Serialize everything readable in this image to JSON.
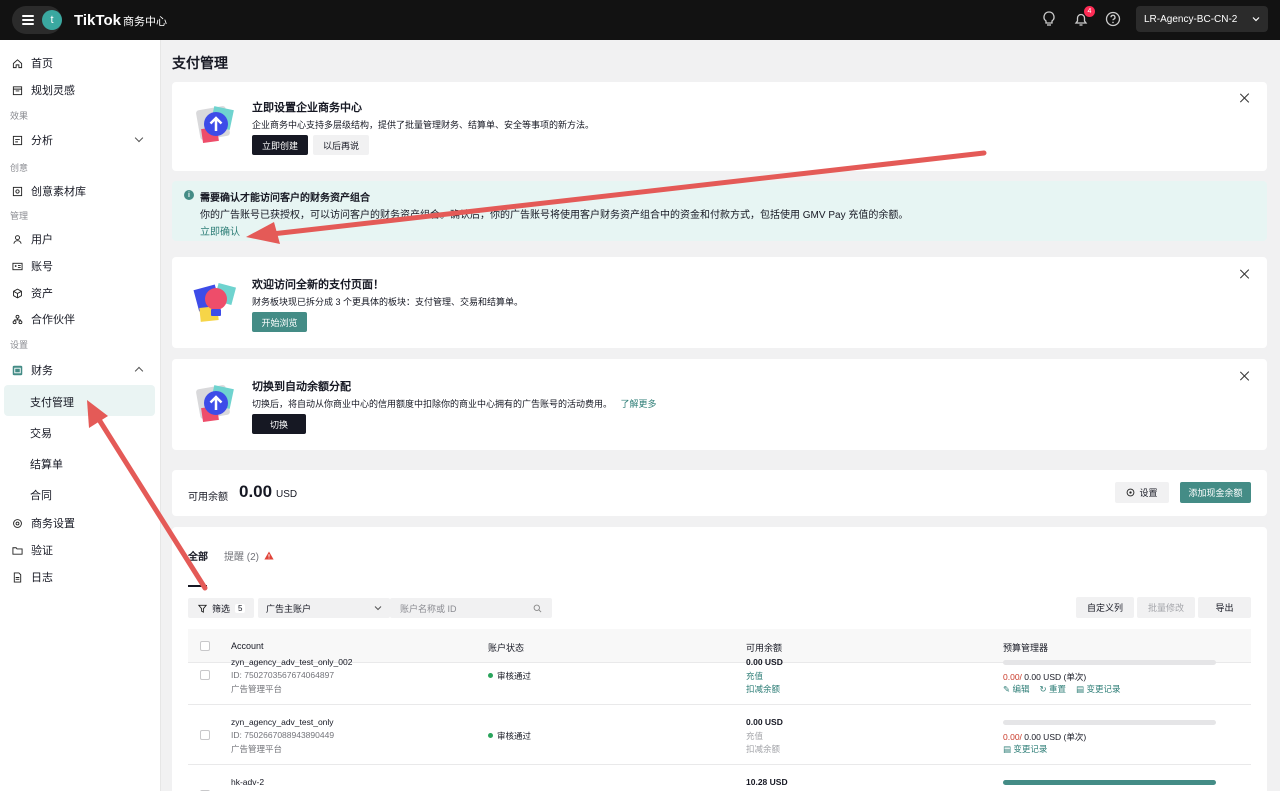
{
  "topbar": {
    "avatar_letter": "t",
    "brand": "TikTok",
    "brand_sub": "商务中心",
    "notification_count": "4",
    "account": "LR-Agency-BC-CN-2"
  },
  "sidebar": {
    "home": "首页",
    "plan": "规划灵感",
    "cat_effect": "效果",
    "analysis": "分析",
    "cat_creative": "创意",
    "creative_library": "创意素材库",
    "cat_manage": "管理",
    "users": "用户",
    "accounts": "账号",
    "assets": "资产",
    "partners": "合作伙伴",
    "cat_settings": "设置",
    "finance": "财务",
    "payment_management": "支付管理",
    "transactions": "交易",
    "statements": "结算单",
    "contracts": "合同",
    "business_settings": "商务设置",
    "verification": "验证",
    "logs": "日志"
  },
  "page": {
    "title": "支付管理"
  },
  "card_create": {
    "title": "立即设置企业商务中心",
    "desc": "企业商务中心支持多层级结构，提供了批量管理财务、结算单、安全等事项的新方法。",
    "primary": "立即创建",
    "secondary": "以后再说"
  },
  "banner": {
    "title": "需要确认才能访问客户的财务资产组合",
    "desc": "你的广告账号已获授权，可以访问客户的财务资产组合。确认后，你的广告账号将使用客户财务资产组合中的资金和付款方式，包括使用 GMV Pay 充值的余额。",
    "link": "立即确认"
  },
  "card_welcome": {
    "title": "欢迎访问全新的支付页面！",
    "desc": "财务板块现已拆分成 3 个更具体的板块：支付管理、交易和结算单。",
    "button": "开始浏览"
  },
  "card_switch": {
    "title": "切换到自动余额分配",
    "desc": "切换后，将自动从你商业中心的信用额度中扣除你的商业中心拥有的广告账号的活动费用。",
    "link": "了解更多",
    "button": "切换"
  },
  "balance": {
    "label": "可用余额",
    "value": "0.00",
    "unit": "USD",
    "settings": "设置",
    "add_cash": "添加现金余额"
  },
  "table": {
    "tab_all": "全部",
    "tab_reminder": "提醒 (2)",
    "filter_label": "筛选",
    "filter_count": "5",
    "select_value": "广告主账户",
    "search_placeholder": "账户名称或 ID",
    "custom_columns": "自定义列",
    "batch_edit": "批量修改",
    "export": "导出",
    "headers": {
      "account": "Account",
      "status": "账户状态",
      "balance": "可用余额",
      "budget": "预算管理器"
    },
    "rows": [
      {
        "name": "zyn_agency_adv_test_only_002",
        "id": "ID: 7502703567674064897",
        "platform": "广告管理平台",
        "status": "审核通过",
        "balance": "0.00 USD",
        "recharge": "充值",
        "deduct": "扣减余额",
        "budget_used": "0.00/",
        "budget_total": "0.00 USD (单次)",
        "edit": "编辑",
        "reset": "重置",
        "history": "变更记录"
      },
      {
        "name": "zyn_agency_adv_test_only",
        "id": "ID: 7502667088943890449",
        "platform": "广告管理平台",
        "status": "审核通过",
        "balance": "0.00 USD",
        "recharge": "充值",
        "deduct": "扣减余额",
        "budget_used": "0.00/",
        "budget_total": "0.00 USD (单次)",
        "history": "变更记录"
      },
      {
        "name": "hk-adv-2",
        "balance": "10.28 USD"
      }
    ]
  }
}
